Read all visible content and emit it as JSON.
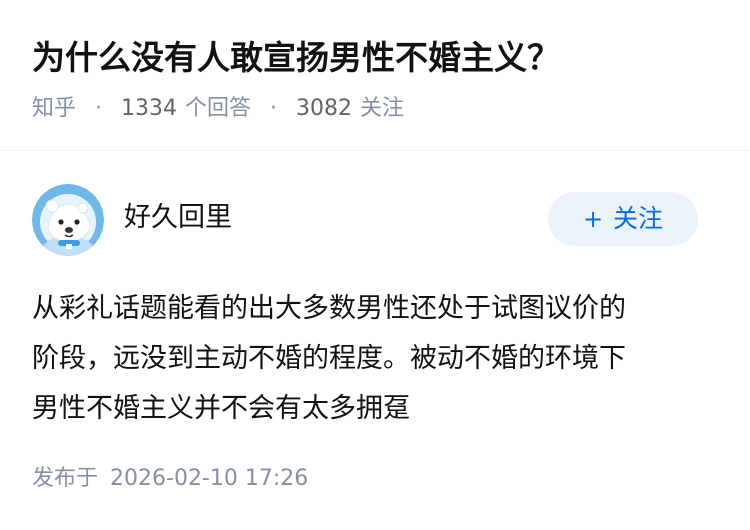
{
  "question": {
    "title": "为什么没有人敢宣扬男性不婚主义？",
    "source": "知乎",
    "answer_count": "1334",
    "answer_label": "个回答",
    "follower_count": "3082",
    "follower_label": "关注",
    "separator": "·"
  },
  "author": {
    "name": "好久回里",
    "avatar_icon": "polar-bear-avatar",
    "follow_label": "关注",
    "follow_plus": "+"
  },
  "answer": {
    "lines": [
      "从彩礼话题能看的出大多数男性还处于试图议价的",
      "阶段，远没到主动不婚的程度。被动不婚的环境下",
      "男性不婚主义并不会有太多拥趸"
    ],
    "published_label": "发布于",
    "published_time": "2026-02-10 17:26"
  },
  "colors": {
    "primary": "#056de8",
    "follow_bg": "#ebf2fa",
    "meta_text": "#8590a6",
    "title_text": "#121212",
    "avatar_bg": "#6fb8ea"
  }
}
